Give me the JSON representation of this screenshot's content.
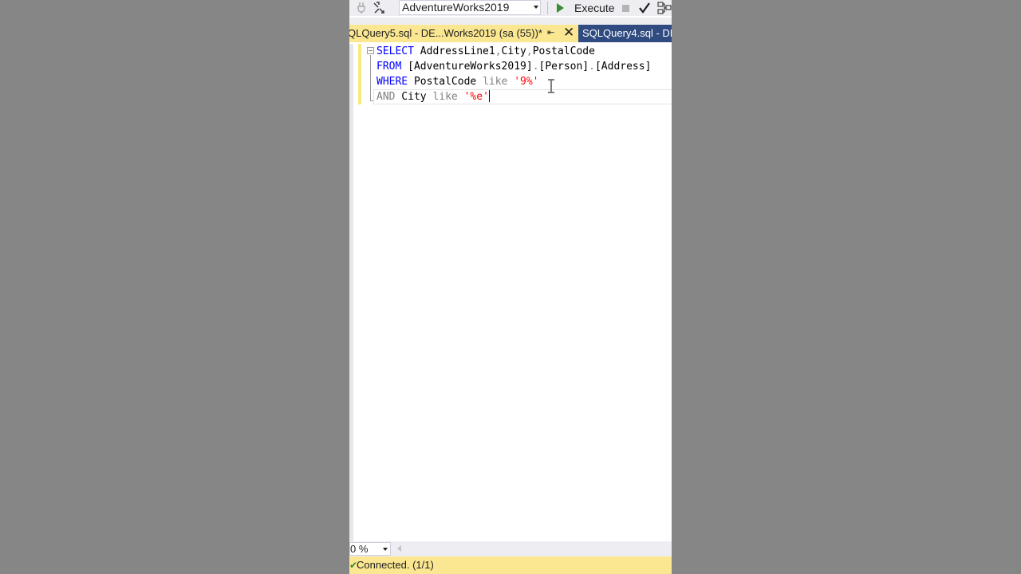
{
  "toolbar": {
    "database": "AdventureWorks2019",
    "execute_label": "Execute"
  },
  "tabs": {
    "active": "QLQuery5.sql - DE...Works2019 (sa (55))*",
    "inactive": "SQLQuery4.sql - DE"
  },
  "editor": {
    "lines": [
      [
        {
          "t": "SELECT",
          "c": "kw"
        },
        {
          "t": " AddressLine1",
          "c": "id"
        },
        {
          "t": ",",
          "c": "op"
        },
        {
          "t": "City",
          "c": "id"
        },
        {
          "t": ",",
          "c": "op"
        },
        {
          "t": "PostalCode",
          "c": "id"
        }
      ],
      [
        {
          "t": "FROM",
          "c": "kw"
        },
        {
          "t": " [AdventureWorks2019]",
          "c": "id"
        },
        {
          "t": ".",
          "c": "op"
        },
        {
          "t": "[Person]",
          "c": "id"
        },
        {
          "t": ".",
          "c": "op"
        },
        {
          "t": "[Address]",
          "c": "id"
        }
      ],
      [
        {
          "t": "WHERE",
          "c": "kw"
        },
        {
          "t": " PostalCode ",
          "c": "id"
        },
        {
          "t": "like",
          "c": "op"
        },
        {
          "t": " ",
          "c": "id"
        },
        {
          "t": "'9%'",
          "c": "str"
        }
      ],
      [
        {
          "t": "AND",
          "c": "op"
        },
        {
          "t": " City ",
          "c": "id"
        },
        {
          "t": "like",
          "c": "op"
        },
        {
          "t": " ",
          "c": "id"
        },
        {
          "t": "'%e'",
          "c": "str"
        }
      ]
    ]
  },
  "zoom": {
    "value": "0 %"
  },
  "status": {
    "text": "Connected. (1/1)"
  },
  "colors": {
    "accent_yellow": "#fbe792",
    "tab_inactive": "#304b80",
    "keyword": "#0000ff",
    "string": "#ff0000",
    "operator": "#808080"
  }
}
